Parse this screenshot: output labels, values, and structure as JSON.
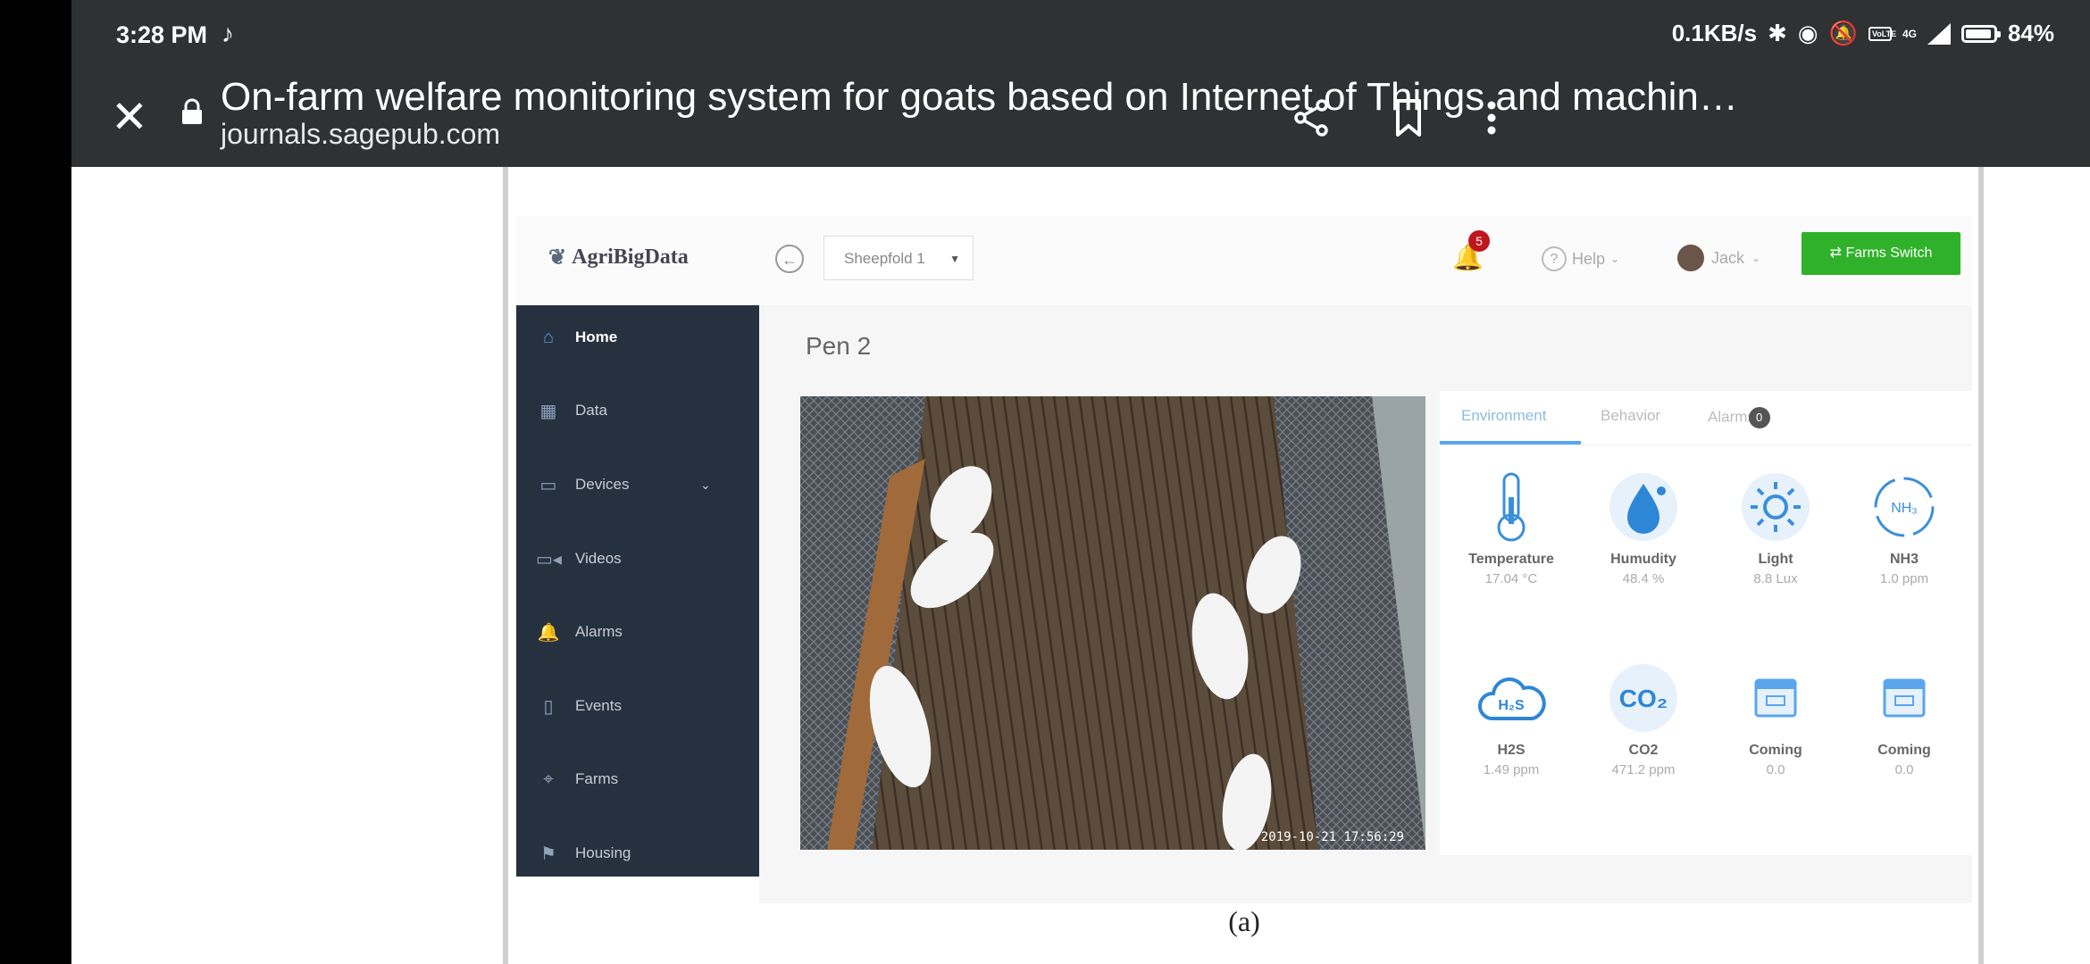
{
  "status_bar": {
    "time": "3:28 PM",
    "network_speed": "0.1KB/s",
    "volte": "VoLTE",
    "network_type": "4G",
    "battery": "84%"
  },
  "toolbar": {
    "title": "On-farm welfare monitoring system for goats based on Internet of Things and machin…",
    "url": "journals.sagepub.com"
  },
  "app": {
    "logo": "AgriBigData",
    "farm_select": "Sheepfold 1",
    "notification_count": "5",
    "help_label": "Help",
    "user_name": "Jack",
    "farm_switch_label": "Farms Switch",
    "sidebar": [
      {
        "label": "Home",
        "icon": "home-icon"
      },
      {
        "label": "Data",
        "icon": "data-icon"
      },
      {
        "label": "Devices",
        "icon": "devices-icon"
      },
      {
        "label": "Videos",
        "icon": "video-icon"
      },
      {
        "label": "Alarms",
        "icon": "bell-icon"
      },
      {
        "label": "Events",
        "icon": "events-icon"
      },
      {
        "label": "Farms",
        "icon": "location-icon"
      },
      {
        "label": "Housing",
        "icon": "flag-icon"
      }
    ],
    "pen_title": "Pen 2",
    "camera_timestamp": "2019-10-21 17:56:29",
    "tabs": {
      "environment": "Environment",
      "behavior": "Behavior",
      "alarms": "Alarms",
      "alarms_badge": "0"
    },
    "sensors": [
      {
        "name": "Temperature",
        "value": "17.04 °C"
      },
      {
        "name": "Humudity",
        "value": "48.4 %"
      },
      {
        "name": "Light",
        "value": "8.8 Lux"
      },
      {
        "name": "NH3",
        "value": "1.0 ppm"
      },
      {
        "name": "H2S",
        "value": "1.49 ppm"
      },
      {
        "name": "CO2",
        "value": "471.2 ppm"
      },
      {
        "name": "Coming",
        "value": "0.0"
      },
      {
        "name": "Coming",
        "value": "0.0"
      }
    ]
  },
  "figure_caption": "(a)",
  "colors": {
    "chrome": "#2f3133",
    "sidebar": "#263140",
    "accent_green": "#2fb22a",
    "accent_blue": "#5aa5ee"
  }
}
